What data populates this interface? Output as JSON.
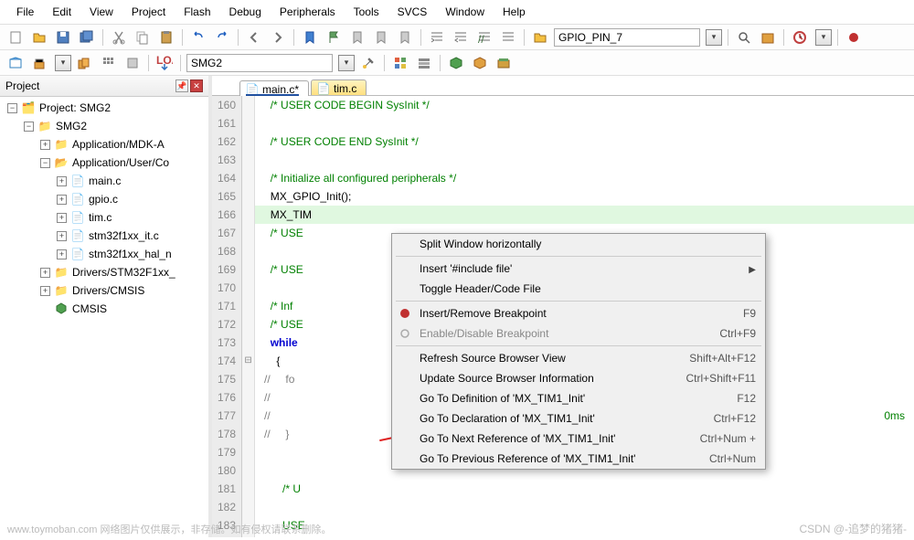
{
  "menubar": [
    "File",
    "Edit",
    "View",
    "Project",
    "Flash",
    "Debug",
    "Peripherals",
    "Tools",
    "SVCS",
    "Window",
    "Help"
  ],
  "toolbar1": {
    "combo1_value": "GPIO_PIN_7"
  },
  "toolbar2": {
    "project_combo": "SMG2"
  },
  "project_panel": {
    "title": "Project",
    "tree": {
      "root": "Project: SMG2",
      "target": "SMG2",
      "groups": [
        "Application/MDK-A",
        "Application/User/Co"
      ],
      "files_user": [
        "main.c",
        "gpio.c",
        "tim.c",
        "stm32f1xx_it.c",
        "stm32f1xx_hal_n"
      ],
      "groups_after": [
        "Drivers/STM32F1xx_",
        "Drivers/CMSIS"
      ],
      "cmsis": "CMSIS"
    }
  },
  "tabs": [
    {
      "label": "main.c*",
      "active": true
    },
    {
      "label": "tim.c",
      "active": false
    }
  ],
  "code": {
    "lines": [
      {
        "n": 160,
        "cls": "comment",
        "text": "/* USER CODE BEGIN SysInit */"
      },
      {
        "n": 161,
        "cls": "",
        "text": ""
      },
      {
        "n": 162,
        "cls": "comment",
        "text": "/* USER CODE END SysInit */"
      },
      {
        "n": 163,
        "cls": "",
        "text": ""
      },
      {
        "n": 164,
        "cls": "comment",
        "text": "/* Initialize all configured peripherals */"
      },
      {
        "n": 165,
        "cls": "code",
        "text": "MX_GPIO_Init();"
      },
      {
        "n": 166,
        "cls": "hl",
        "text": "MX_TIM"
      },
      {
        "n": 167,
        "cls": "comment",
        "text": "/* USE"
      },
      {
        "n": 168,
        "cls": "",
        "text": ""
      },
      {
        "n": 169,
        "cls": "comment",
        "text": "/* USE"
      },
      {
        "n": 170,
        "cls": "",
        "text": ""
      },
      {
        "n": 171,
        "cls": "comment",
        "text": "/* Inf"
      },
      {
        "n": 172,
        "cls": "comment",
        "text": "/* USE"
      },
      {
        "n": 173,
        "cls": "keyword",
        "text": "while "
      },
      {
        "n": 174,
        "cls": "code",
        "text": "{"
      },
      {
        "n": 175,
        "cls": "disabled",
        "text": "//     fo"
      },
      {
        "n": 176,
        "cls": "disabled",
        "text": "//"
      },
      {
        "n": 177,
        "cls": "disabled",
        "text": "//"
      },
      {
        "n": 178,
        "cls": "disabled",
        "text": "//     }"
      },
      {
        "n": 179,
        "cls": "",
        "text": ""
      },
      {
        "n": 180,
        "cls": "",
        "text": ""
      },
      {
        "n": 181,
        "cls": "comment",
        "text": "  /* U"
      },
      {
        "n": 182,
        "cls": "",
        "text": ""
      },
      {
        "n": 183,
        "cls": "comment",
        "text": "  USE"
      }
    ],
    "afterlines": {
      "175": "",
      "177": "0ms",
      "179": "  /* U"
    }
  },
  "context_menu": {
    "items": [
      {
        "label": "Split Window horizontally",
        "shortcut": "",
        "enabled": true
      },
      {
        "sep": true
      },
      {
        "label": "Insert '#include file'",
        "shortcut": "",
        "enabled": true,
        "submenu": true
      },
      {
        "label": "Toggle Header/Code File",
        "shortcut": "",
        "enabled": true
      },
      {
        "sep": true
      },
      {
        "label": "Insert/Remove Breakpoint",
        "shortcut": "F9",
        "enabled": true,
        "icon": "red"
      },
      {
        "label": "Enable/Disable Breakpoint",
        "shortcut": "Ctrl+F9",
        "enabled": false,
        "icon": "circle"
      },
      {
        "sep": true
      },
      {
        "label": "Refresh Source Browser View",
        "shortcut": "Shift+Alt+F12",
        "enabled": true
      },
      {
        "label": "Update Source Browser Information",
        "shortcut": "Ctrl+Shift+F11",
        "enabled": true
      },
      {
        "label": "Go To Definition of 'MX_TIM1_Init'",
        "shortcut": "F12",
        "enabled": true
      },
      {
        "label": "Go To Declaration of 'MX_TIM1_Init'",
        "shortcut": "Ctrl+F12",
        "enabled": true
      },
      {
        "label": "Go To Next Reference of 'MX_TIM1_Init'",
        "shortcut": "Ctrl+Num +",
        "enabled": true
      },
      {
        "label": "Go To Previous Reference of 'MX_TIM1_Init'",
        "shortcut": "Ctrl+Num",
        "enabled": true
      }
    ]
  },
  "watermarks": {
    "left": "www.toymoban.com  网络图片仅供展示，非存储。如有侵权请联系删除。",
    "right": "CSDN @-追梦的猪猪-"
  }
}
